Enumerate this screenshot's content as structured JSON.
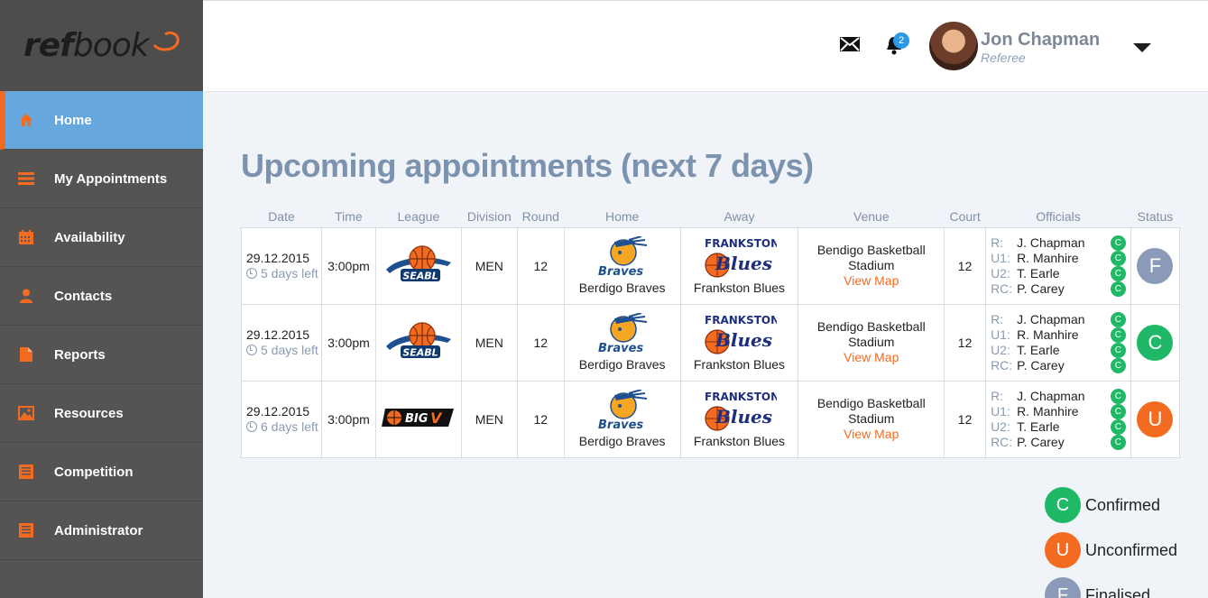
{
  "app": {
    "logo_regular": "ref",
    "logo_rest": "book"
  },
  "sidebar": {
    "items": [
      {
        "label": "Home",
        "icon": "home-icon",
        "active": true
      },
      {
        "label": "My Appointments",
        "icon": "list-icon"
      },
      {
        "label": "Availability",
        "icon": "calendar-icon"
      },
      {
        "label": "Contacts",
        "icon": "person-icon"
      },
      {
        "label": "Reports",
        "icon": "document-icon"
      },
      {
        "label": "Resources",
        "icon": "image-icon"
      },
      {
        "label": "Competition",
        "icon": "clipboard-icon"
      },
      {
        "label": "Administrator",
        "icon": "clipboard-icon"
      }
    ]
  },
  "header": {
    "notifications_count": "2",
    "user_name": "Jon Chapman",
    "user_role": "Referee"
  },
  "main": {
    "title": "Upcoming appointments (next 7 days)",
    "columns": [
      "Date",
      "Time",
      "League",
      "Division",
      "Round",
      "Home",
      "Away",
      "Venue",
      "Court",
      "Officials",
      "Status"
    ],
    "rows": [
      {
        "date": "29.12.2015",
        "days_left": "5 days left",
        "time": "3:00pm",
        "league": "SEABL",
        "division": "MEN",
        "round": "12",
        "home": "Berdigo Braves",
        "away": "Frankston Blues",
        "venue": "Bendigo Basketball Stadium",
        "view_map": "View Map",
        "court": "12",
        "officials": [
          {
            "role": "R:",
            "name": "J. Chapman",
            "status": "C"
          },
          {
            "role": "U1:",
            "name": "R. Manhire",
            "status": "C"
          },
          {
            "role": "U2:",
            "name": "T. Earle",
            "status": "C"
          },
          {
            "role": "RC:",
            "name": "P. Carey",
            "status": "C"
          }
        ],
        "status": "F",
        "status_color": "#8a9ab8"
      },
      {
        "date": "29.12.2015",
        "days_left": "5 days left",
        "time": "3:00pm",
        "league": "SEABL",
        "division": "MEN",
        "round": "12",
        "home": "Berdigo Braves",
        "away": "Frankston Blues",
        "venue": "Bendigo Basketball Stadium",
        "view_map": "View Map",
        "court": "12",
        "officials": [
          {
            "role": "R:",
            "name": "J. Chapman",
            "status": "C"
          },
          {
            "role": "U1:",
            "name": "R. Manhire",
            "status": "C"
          },
          {
            "role": "U2:",
            "name": "T. Earle",
            "status": "C"
          },
          {
            "role": "RC:",
            "name": "P. Carey",
            "status": "C"
          }
        ],
        "status": "C",
        "status_color": "#1fb866"
      },
      {
        "date": "29.12.2015",
        "days_left": "6 days left",
        "time": "3:00pm",
        "league": "BIG V",
        "division": "MEN",
        "round": "12",
        "home": "Berdigo Braves",
        "away": "Frankston Blues",
        "venue": "Bendigo Basketball Stadium",
        "view_map": "View Map",
        "court": "12",
        "officials": [
          {
            "role": "R:",
            "name": "J. Chapman",
            "status": "C"
          },
          {
            "role": "U1:",
            "name": "R. Manhire",
            "status": "C"
          },
          {
            "role": "U2:",
            "name": "T. Earle",
            "status": "C"
          },
          {
            "role": "RC:",
            "name": "P. Carey",
            "status": "C"
          }
        ],
        "status": "U",
        "status_color": "#f26b21"
      }
    ]
  },
  "legend": [
    {
      "letter": "C",
      "label": "Confirmed",
      "color": "#1fb866"
    },
    {
      "letter": "U",
      "label": "Unconfirmed",
      "color": "#f26b21"
    },
    {
      "letter": "F",
      "label": "Finalised",
      "color": "#8a9ab8"
    }
  ],
  "colors": {
    "accent": "#f26b21",
    "active_nav": "#66a8dd",
    "sidebar": "#555453",
    "title": "#7c93b0"
  }
}
